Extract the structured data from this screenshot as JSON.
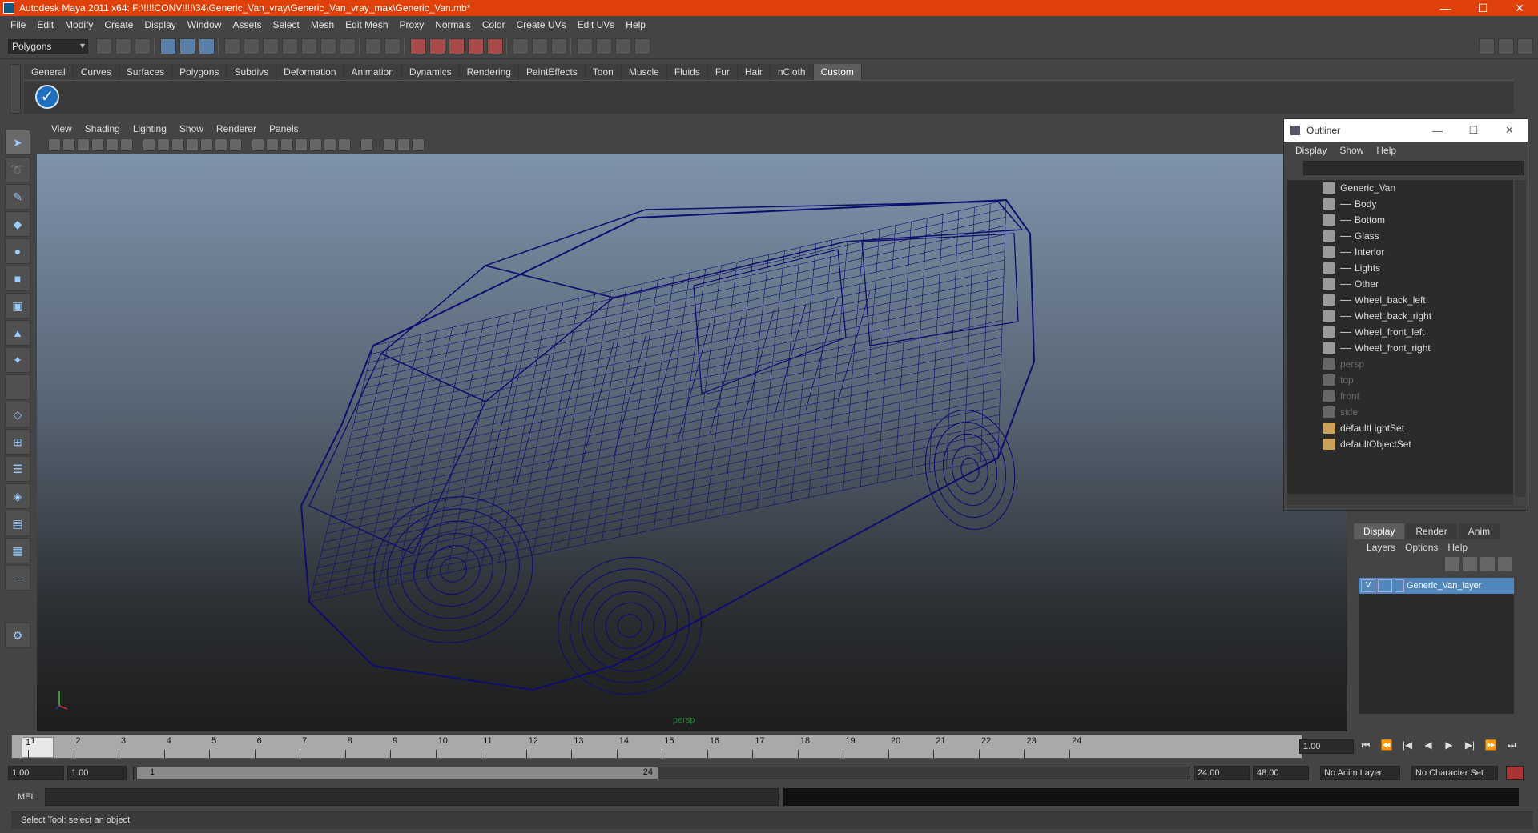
{
  "window": {
    "title": "Autodesk Maya 2011 x64: F:\\!!!!CONV!!!!\\34\\Generic_Van_vray\\Generic_Van_vray_max\\Generic_Van.mb*",
    "min": "—",
    "max": "☐",
    "close": "✕"
  },
  "menubar": [
    "File",
    "Edit",
    "Modify",
    "Create",
    "Display",
    "Window",
    "Assets",
    "Select",
    "Mesh",
    "Edit Mesh",
    "Proxy",
    "Normals",
    "Color",
    "Create UVs",
    "Edit UVs",
    "Help"
  ],
  "toolbar": {
    "mode": "Polygons"
  },
  "shelf": {
    "tabs": [
      "General",
      "Curves",
      "Surfaces",
      "Polygons",
      "Subdivs",
      "Deformation",
      "Animation",
      "Dynamics",
      "Rendering",
      "PaintEffects",
      "Toon",
      "Muscle",
      "Fluids",
      "Fur",
      "Hair",
      "nCloth",
      "Custom"
    ],
    "active_tab": "Custom",
    "check_icon": "✓"
  },
  "viewport": {
    "menu": [
      "View",
      "Shading",
      "Lighting",
      "Show",
      "Renderer",
      "Panels"
    ],
    "camera_label": "persp",
    "wire_color": "#0d0d6e"
  },
  "outliner": {
    "title": "Outliner",
    "menu": [
      "Display",
      "Show",
      "Help"
    ],
    "items": [
      {
        "label": "Generic_Van",
        "indent": 0,
        "dim": false
      },
      {
        "label": "Body",
        "indent": 1,
        "dim": false
      },
      {
        "label": "Bottom",
        "indent": 1,
        "dim": false
      },
      {
        "label": "Glass",
        "indent": 1,
        "dim": false
      },
      {
        "label": "Interior",
        "indent": 1,
        "dim": false
      },
      {
        "label": "Lights",
        "indent": 1,
        "dim": false
      },
      {
        "label": "Other",
        "indent": 1,
        "dim": false
      },
      {
        "label": "Wheel_back_left",
        "indent": 1,
        "dim": false
      },
      {
        "label": "Wheel_back_right",
        "indent": 1,
        "dim": false
      },
      {
        "label": "Wheel_front_left",
        "indent": 1,
        "dim": false
      },
      {
        "label": "Wheel_front_right",
        "indent": 1,
        "dim": false
      },
      {
        "label": "persp",
        "indent": 0,
        "dim": true
      },
      {
        "label": "top",
        "indent": 0,
        "dim": true
      },
      {
        "label": "front",
        "indent": 0,
        "dim": true
      },
      {
        "label": "side",
        "indent": 0,
        "dim": true
      },
      {
        "label": "defaultLightSet",
        "indent": 0,
        "dim": false
      },
      {
        "label": "defaultObjectSet",
        "indent": 0,
        "dim": false
      }
    ]
  },
  "layers": {
    "tabs": [
      "Display",
      "Render",
      "Anim"
    ],
    "active_tab": "Display",
    "menu": [
      "Layers",
      "Options",
      "Help"
    ],
    "layer": {
      "visible": "V",
      "name": "Generic_Van_layer"
    }
  },
  "timeline": {
    "ticks": [
      "1",
      "2",
      "3",
      "4",
      "5",
      "6",
      "7",
      "8",
      "9",
      "10",
      "11",
      "12",
      "13",
      "14",
      "15",
      "16",
      "17",
      "18",
      "19",
      "20",
      "21",
      "22",
      "23",
      "24"
    ],
    "current": "1",
    "current_field": "1.00"
  },
  "range": {
    "start": "1.00",
    "playback_start": "1.00",
    "handle_start": "1",
    "handle_end": "24",
    "playback_end": "24.00",
    "end": "48.00",
    "anim_layer": "No Anim Layer",
    "character_set": "No Character Set"
  },
  "cmdline": {
    "label": "MEL"
  },
  "help": {
    "text": "Select Tool: select an object"
  }
}
